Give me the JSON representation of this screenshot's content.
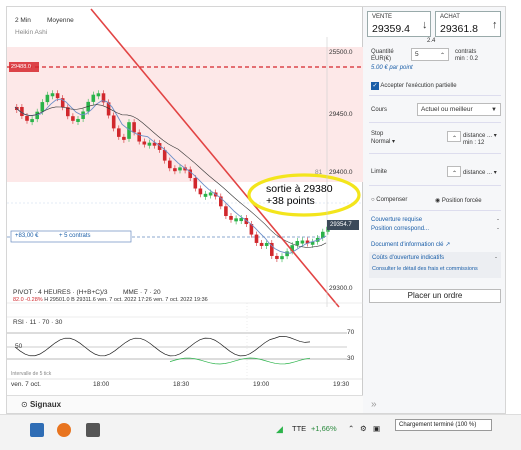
{
  "chart": {
    "timeframe": "2 Min",
    "indicator_name": "Moyenne",
    "heikin": "Heikin Ashi",
    "price_ticks": [
      "25500.0",
      "29450.0",
      "29400.0",
      "29300.0"
    ],
    "left_tag": "29488.0",
    "tag_81": "81",
    "current_price_tag": "29354.7",
    "position_label": "+83,00 €",
    "position_contracts": "+ 5 contrats",
    "pivot_line": "PIVOT · 4 HEURES · (H+B+C)/3",
    "mme_line": "MME · 7 · 20",
    "info_line_vals": [
      "82.0",
      "-0.28%",
      "H 29501.0",
      "B 29311.6",
      "ven. 7 oct. 2022 17:26",
      "ven. 7 oct. 2022 19:36"
    ],
    "rsi_label": "RSI · 11 · 70 · 30",
    "rsi_levels": [
      "70",
      "50",
      "30"
    ],
    "time_ticks": [
      "18:00",
      "18:30",
      "19:00",
      "19:30"
    ],
    "date_label": "ven. 7 oct.",
    "left_small": "Intervalle de 5 tick",
    "annotation_line1": "sortie à 29380",
    "annotation_line2": "+38 points",
    "signaux": "Signaux",
    "colors": {
      "up": "#2bb34a",
      "down": "#d1282d",
      "trend": "#e24444",
      "ellipse": "#f6ea20",
      "resistance_band": "#fde6e6"
    }
  },
  "order": {
    "sell_label": "VENTE",
    "sell_price": "29359.4",
    "buy_label": "ACHAT",
    "buy_price": "29361.8",
    "spread": "2.4",
    "qty_label": "Quantité",
    "qty_unit": "EUR(€)",
    "qty_value": "5",
    "contracts_label": "contrats",
    "min_label": "min : 0.2",
    "per_point": "5.00 € par point",
    "accept_partial": "Accepter l'exécution partielle",
    "cours_label": "Cours",
    "cours_value": "Actuel ou meilleur",
    "stop_label": "Stop",
    "stop_mode": "Normal",
    "stop_distance": "distance ...",
    "stop_min": "min : 12",
    "limite_label": "Limite",
    "limite_distance": "distance ...",
    "compenser": "Compenser",
    "position_forcee": "Position forcée",
    "couverture_requise": "Couverture requise",
    "position_correspond": "Position correspond...",
    "doc_info": "Document d'information clé",
    "couts_label": "Coûts d'ouverture indicatifs",
    "couts_link": "Consulter le détail des frais et commissions",
    "dash": "-",
    "placer_ordre": "Placer un ordre"
  },
  "taskbar": {
    "tte": "TTE",
    "tte_change": "+1,66%",
    "toast": "Chargement terminé (100 %)"
  }
}
